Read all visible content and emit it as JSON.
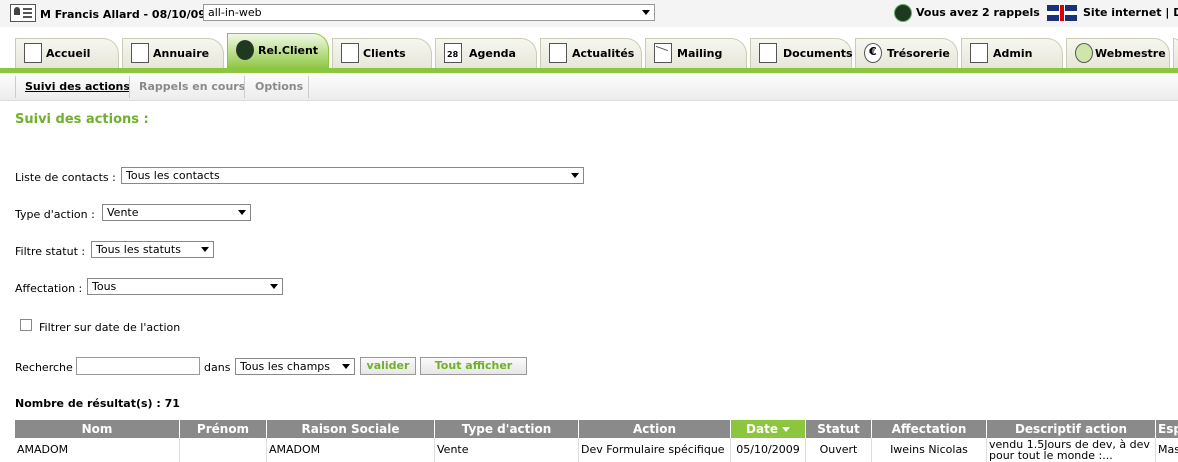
{
  "topbar": {
    "user_label": "M Francis Allard - 08/10/09",
    "site_select": "all-in-web",
    "rappels": "Vous avez 2 rappels",
    "site_link": "Site internet | Dé"
  },
  "tabs": [
    {
      "label": "Accueil",
      "icon": "home-icon"
    },
    {
      "label": "Annuaire",
      "icon": "book-icon"
    },
    {
      "label": "Rel.Client",
      "icon": "headset-icon"
    },
    {
      "label": "Clients",
      "icon": "chart-icon"
    },
    {
      "label": "Agenda",
      "icon": "calendar-icon"
    },
    {
      "label": "Actualités",
      "icon": "news-icon"
    },
    {
      "label": "Mailing",
      "icon": "mail-icon"
    },
    {
      "label": "Documents",
      "icon": "folder-icon"
    },
    {
      "label": "Trésorerie",
      "icon": "euro-icon"
    },
    {
      "label": "Admin",
      "icon": "admin-icon"
    },
    {
      "label": "Webmestre",
      "icon": "globe-icon"
    }
  ],
  "subnav": {
    "suivi": "Suivi des actions",
    "rappels": "Rappels en cours",
    "options": "Options"
  },
  "page_title": "Suivi des actions :",
  "filters": {
    "contacts_label": "Liste de contacts :",
    "contacts_value": "Tous les contacts",
    "type_label": "Type d'action :",
    "type_value": "Vente",
    "statut_label": "Filtre statut :",
    "statut_value": "Tous les statuts",
    "affectation_label": "Affectation :",
    "affectation_value": "Tous",
    "date_filter_label": "Filtrer sur date de l'action",
    "recherche_label": "Recherche",
    "dans_label": "dans",
    "champs_value": "Tous les champs",
    "valider": "valider",
    "tout_afficher": "Tout afficher"
  },
  "result_count": "Nombre de résultat(s) : 71",
  "table": {
    "headers": [
      "Nom",
      "Prénom",
      "Raison Sociale",
      "Type d'action",
      "Action",
      "Date",
      "Statut",
      "Affectation",
      "Descriptif action",
      "Esp"
    ],
    "rows": [
      [
        "AMADOM",
        "",
        "AMADOM",
        "Vente",
        "Dev Formulaire spécifique",
        "05/10/2009",
        "Ouvert",
        "Iweins Nicolas",
        "vendu 1.5Jours de dev, à dev pour tout le monde :...",
        "Mas"
      ]
    ]
  },
  "colors": {
    "accent": "#8cc63f",
    "title_green": "#6fb12b",
    "header_gray": "#8a8a8a"
  }
}
